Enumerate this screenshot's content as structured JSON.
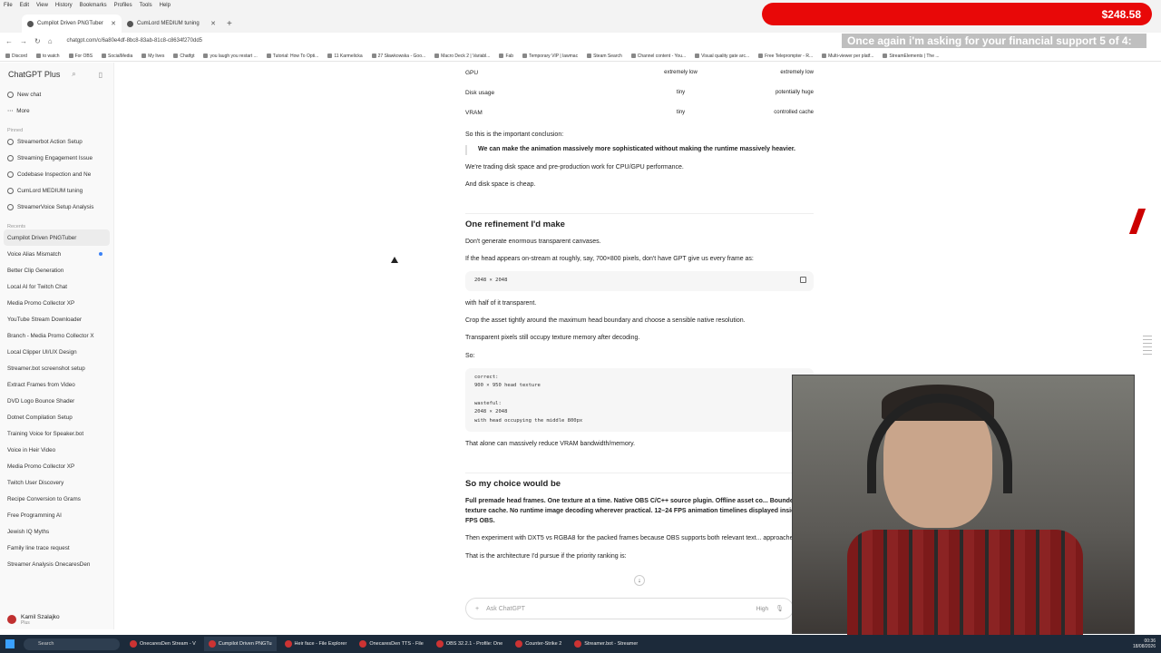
{
  "menu": [
    "File",
    "Edit",
    "View",
    "History",
    "Bookmarks",
    "Profiles",
    "Tools",
    "Help"
  ],
  "tabs": [
    {
      "label": "Cumpilot Driven PNGTuber",
      "active": true
    },
    {
      "label": "CumLord MEDIUM tuning",
      "active": false
    }
  ],
  "donation": {
    "amount": "$248.58",
    "color": "#e80808"
  },
  "overlay_text": "Once again i'm asking for your financial support 5 of 4:",
  "address": {
    "url": "chatgpt.com/c/6a80e4df-8bc8-83ab-81c8-c8634f270dd5"
  },
  "bookmarks": [
    "Discord",
    "to watch",
    "For OBS",
    "SocialMedia",
    "My lives",
    "Chatfgt",
    "you laugh you restart ...",
    "Tutorial: How To Opti...",
    "11 Karmelicka",
    "27 Sławkowska - Goo...",
    "Macro Deck 2 | Variabl...",
    "Fab",
    "Temporary VIP | lawmac",
    "Steam Search",
    "Channel content - You...",
    "Visual quality gate arc...",
    "Free Teleprompter - R...",
    "Multi-viewer per platf...",
    "StreamElements | The ..."
  ],
  "sidebar": {
    "title": "ChatGPT Plus",
    "top": [
      "New chat",
      "More"
    ],
    "pinned_label": "Pinned",
    "pinned": [
      "Streamerbot Action Setup",
      "Streaming Engagement Issue",
      "Codebase Inspection and Ne",
      "CumLord MEDIUM tuning",
      "StreamerVoice Setup Analysis"
    ],
    "recents_label": "Recents",
    "recents": [
      "Cumpilot Driven PNGTuber",
      "Voice Alias Mismatch",
      "Better Clip Generation",
      "Local AI for Twitch Chat",
      "Media Promo Collector XP",
      "YouTube Stream Downloader",
      "Branch - Media Promo Collector X",
      "Local Clipper UI/UX Design",
      "Streamer.bot screenshot setup",
      "Extract Frames from Video",
      "DVD Logo Bounce Shader",
      "Dotnet Compilation Setup",
      "Training Voice for Speaker.bot",
      "Voice in Heir Video",
      "Media Promo Collector XP",
      "Twitch User Discovery",
      "Recipe Conversion to Grams",
      "Free Programming AI",
      "Jewish IQ Myths",
      "Family line trace request",
      "Streamer Analysis OnecaresDen"
    ],
    "user": {
      "name": "Kamil Szalajko",
      "plan": "Plus"
    }
  },
  "content": {
    "table": [
      [
        "GPU",
        "extremely low",
        "extremely low"
      ],
      [
        "Disk usage",
        "tiny",
        "potentially huge"
      ],
      [
        "VRAM",
        "tiny",
        "controlled cache"
      ]
    ],
    "p1": "So this is the important conclusion:",
    "quote": "We can make the animation massively more sophisticated without making the runtime massively heavier.",
    "p2": "We're trading disk space and pre-production work for CPU/GPU performance.",
    "p3": "And disk space is cheap.",
    "h1": "One refinement I'd make",
    "p4": "Don't generate enormous transparent canvases.",
    "p5": "If the head appears on-stream at roughly, say, 700×800 pixels, don't have GPT give us every frame as:",
    "code1": "2048 × 2048",
    "p6": "with half of it transparent.",
    "p7": "Crop the asset tightly around the maximum head boundary and choose a sensible native resolution.",
    "p8": "Transparent pixels still occupy texture memory after decoding.",
    "p9": "So:",
    "code2": "correct:\n900 × 950 head texture\n\nwasteful:\n2048 × 2048\nwith head occupying the middle 800px",
    "p10": "That alone can massively reduce VRAM bandwidth/memory.",
    "h2": "So my choice would be",
    "p11": "Full premade head frames. One texture at a time. Native OBS C/C++ source plugin. Offline asset co... Bounded GPU texture cache. No runtime image decoding wherever practical. 12–24 FPS animation timelines displayed inside 60 FPS OBS.",
    "p12": "Then experiment with DXT5 vs RGBA8 for the packed frames because OBS supports both relevant text... approaches.",
    "p13": "That is the architecture I'd pursue if the priority ranking is:"
  },
  "composer": {
    "placeholder": "Ask ChatGPT",
    "mode": "High"
  },
  "taskbar": {
    "search": "Search",
    "apps": [
      "OnecaresDen Stream - V",
      "Cumpilot Driven PNGTu",
      "Heir face - File Explorer",
      "OnecaresDen TTS - File",
      "OBS 32.2.1 - Profile: One",
      "Counter-Strike 2",
      "Streamer.bot - Streamer"
    ],
    "time": "00:36",
    "date": "18/08/2026"
  }
}
